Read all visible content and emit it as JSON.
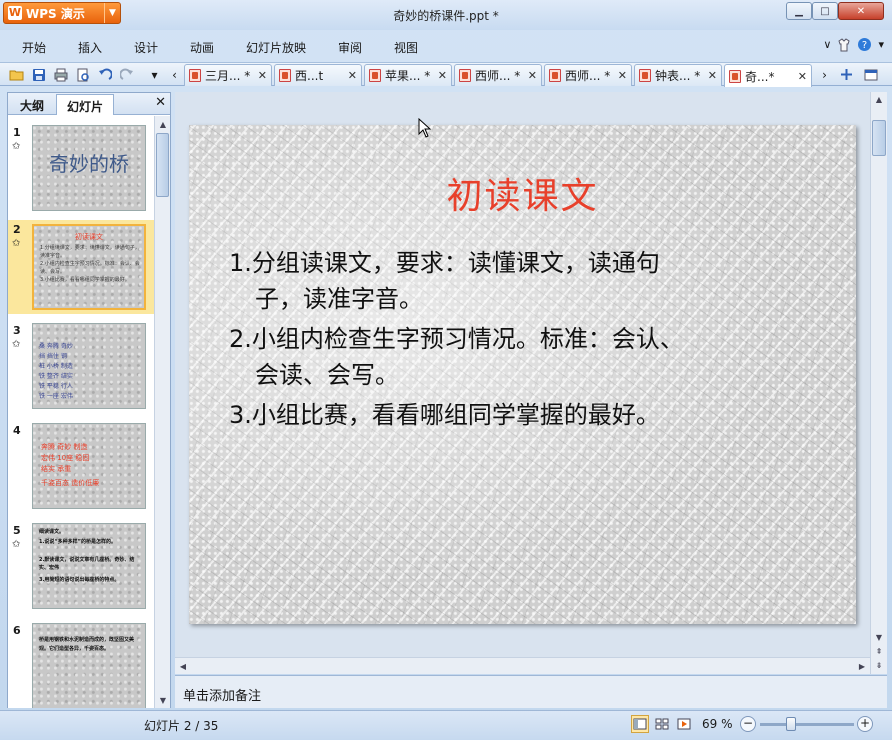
{
  "window": {
    "app_label": "WPS 演示",
    "title": "奇妙的桥课件.ppt *",
    "min": "▁",
    "max": "□",
    "close": "✕"
  },
  "menu": {
    "items": [
      "开始",
      "插入",
      "设计",
      "动画",
      "幻灯片放映",
      "审阅",
      "视图"
    ]
  },
  "doc_tabs": [
    {
      "label": "三月... *",
      "active": false
    },
    {
      "label": "西...t",
      "active": false
    },
    {
      "label": "苹果... *",
      "active": false
    },
    {
      "label": "西师... *",
      "active": false
    },
    {
      "label": "西师... *",
      "active": false
    },
    {
      "label": "钟表... *",
      "active": false
    },
    {
      "label": "奇...*",
      "active": true
    }
  ],
  "left_pane": {
    "tabs": [
      "大纲",
      "幻灯片"
    ],
    "active_tab": "幻灯片",
    "thumbnails": [
      {
        "number": "1",
        "star": "✩",
        "title": "奇妙的桥",
        "lines": [],
        "selected": false
      },
      {
        "number": "2",
        "star": "✩",
        "title": "初读课文",
        "lines": [
          "1.分组读课文，要求：读懂课文，读通句子，读准字音。",
          "2.小组内检查生字预习情况。标准：会认、会读、会写。",
          "3.小组比赛，看看哪组同学掌握的最好。"
        ],
        "selected": true
      },
      {
        "number": "3",
        "star": "✩",
        "title": "",
        "lines": [
          "桑 奔腾 奇妙",
          "挡 挡住 钢",
          "桩 小桥 制造",
          "铁 整齐 结实",
          "铁 平稳 行人",
          "铁 一座 宏伟"
        ],
        "selected": false
      },
      {
        "number": "4",
        "star": "",
        "title": "",
        "lines": [
          "奔腾 奇妙 制造",
          "宏伟 10座 稳固",
          "结实 承重",
          "千姿百态 造价低廉"
        ],
        "selected": false
      },
      {
        "number": "5",
        "star": "✩",
        "title": "",
        "lines": [
          "细读课文。",
          "1.说说“多种多样”的桥是怎样的。",
          "2.默读课文，说说文章有几座桥。奇妙、结实、宏伟",
          "3.用简短的语句说出每座桥的特点。"
        ],
        "selected": false
      },
      {
        "number": "6",
        "star": "",
        "title": "",
        "lines": [
          "桥是用钢铁和水泥制造而成的，既坚固又美观。它们造型各异，千姿百态。"
        ],
        "selected": false
      }
    ]
  },
  "slide": {
    "title": "初读课文",
    "bullets": [
      {
        "num": "1.",
        "text": "分组读课文，要求：读懂课文，读通句",
        "cont": "子，读准字音。"
      },
      {
        "num": "2.",
        "text": "小组内检查生字预习情况。标准：会认、",
        "cont": "会读、会写。"
      },
      {
        "num": "3.",
        "text": "小组比赛，看看哪组同学掌握的最好。",
        "cont": ""
      }
    ],
    "colors": {
      "title": "#e8402b"
    }
  },
  "notes": {
    "placeholder": "单击添加备注"
  },
  "status": {
    "slide_count": "幻灯片 2 / 35",
    "zoom": "69 %",
    "minus": "−",
    "plus": "+"
  }
}
